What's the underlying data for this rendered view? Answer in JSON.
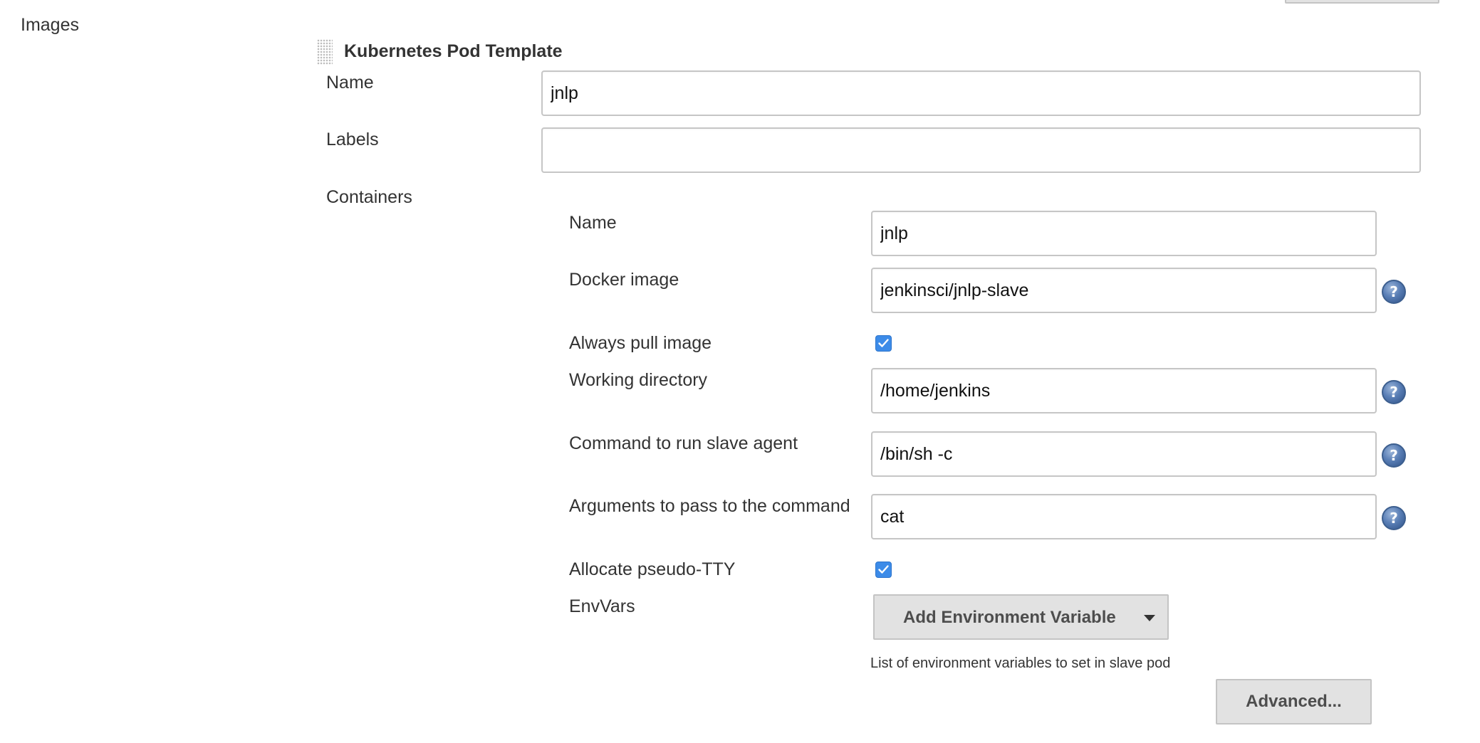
{
  "section_label": "Images",
  "pod_template": {
    "title": "Kubernetes Pod Template",
    "name_label": "Name",
    "name_value": "jnlp",
    "labels_label": "Labels",
    "labels_value": "",
    "containers_label": "Containers"
  },
  "container": {
    "name_label": "Name",
    "name_value": "jnlp",
    "docker_image_label": "Docker image",
    "docker_image_value": "jenkinsci/jnlp-slave",
    "always_pull_label": "Always pull image",
    "always_pull_checked": true,
    "working_dir_label": "Working directory",
    "working_dir_value": "/home/jenkins",
    "command_label": "Command to run slave agent",
    "command_value": "/bin/sh -c",
    "args_label": "Arguments to pass to the command",
    "args_value": "cat",
    "tty_label": "Allocate pseudo-TTY",
    "tty_checked": true,
    "envvars_label": "EnvVars",
    "add_env_button": "Add Environment Variable",
    "envvars_help": "List of environment variables to set in slave pod",
    "advanced_button": "Advanced..."
  },
  "help_icon_glyph": "?",
  "colors": {
    "checkbox": "#3c8be8",
    "button_bg": "#e2e2e2",
    "help_icon": "#4a6fa5"
  },
  "icons": [
    "drag-handle-icon",
    "help-icon",
    "checkmark-icon",
    "caret-down-icon"
  ]
}
